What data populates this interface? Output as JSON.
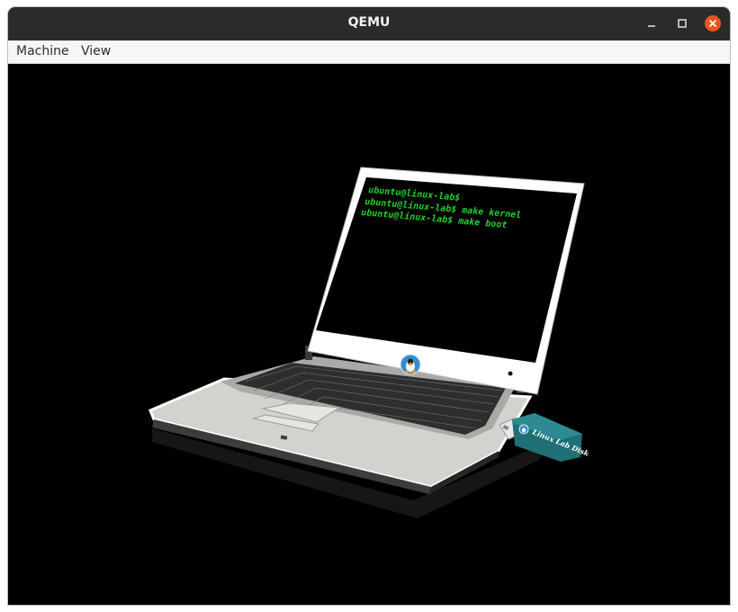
{
  "window": {
    "title": "QEMU"
  },
  "menubar": {
    "items": [
      "Machine",
      "View"
    ]
  },
  "screen": {
    "terminal_lines": [
      "ubuntu@linux-lab$",
      "ubuntu@linux-lab$ make kernel",
      "ubuntu@linux-lab$ make boot"
    ],
    "usb_label": "Linux Lab Disk"
  },
  "colors": {
    "titlebar": "#2b2b2b",
    "close_button": "#e95420",
    "terminal_text": "#1fd12a",
    "usb_body": "#1f6f74"
  },
  "icons": [
    "minimize-icon",
    "maximize-icon",
    "close-icon",
    "tux-logo-icon"
  ]
}
